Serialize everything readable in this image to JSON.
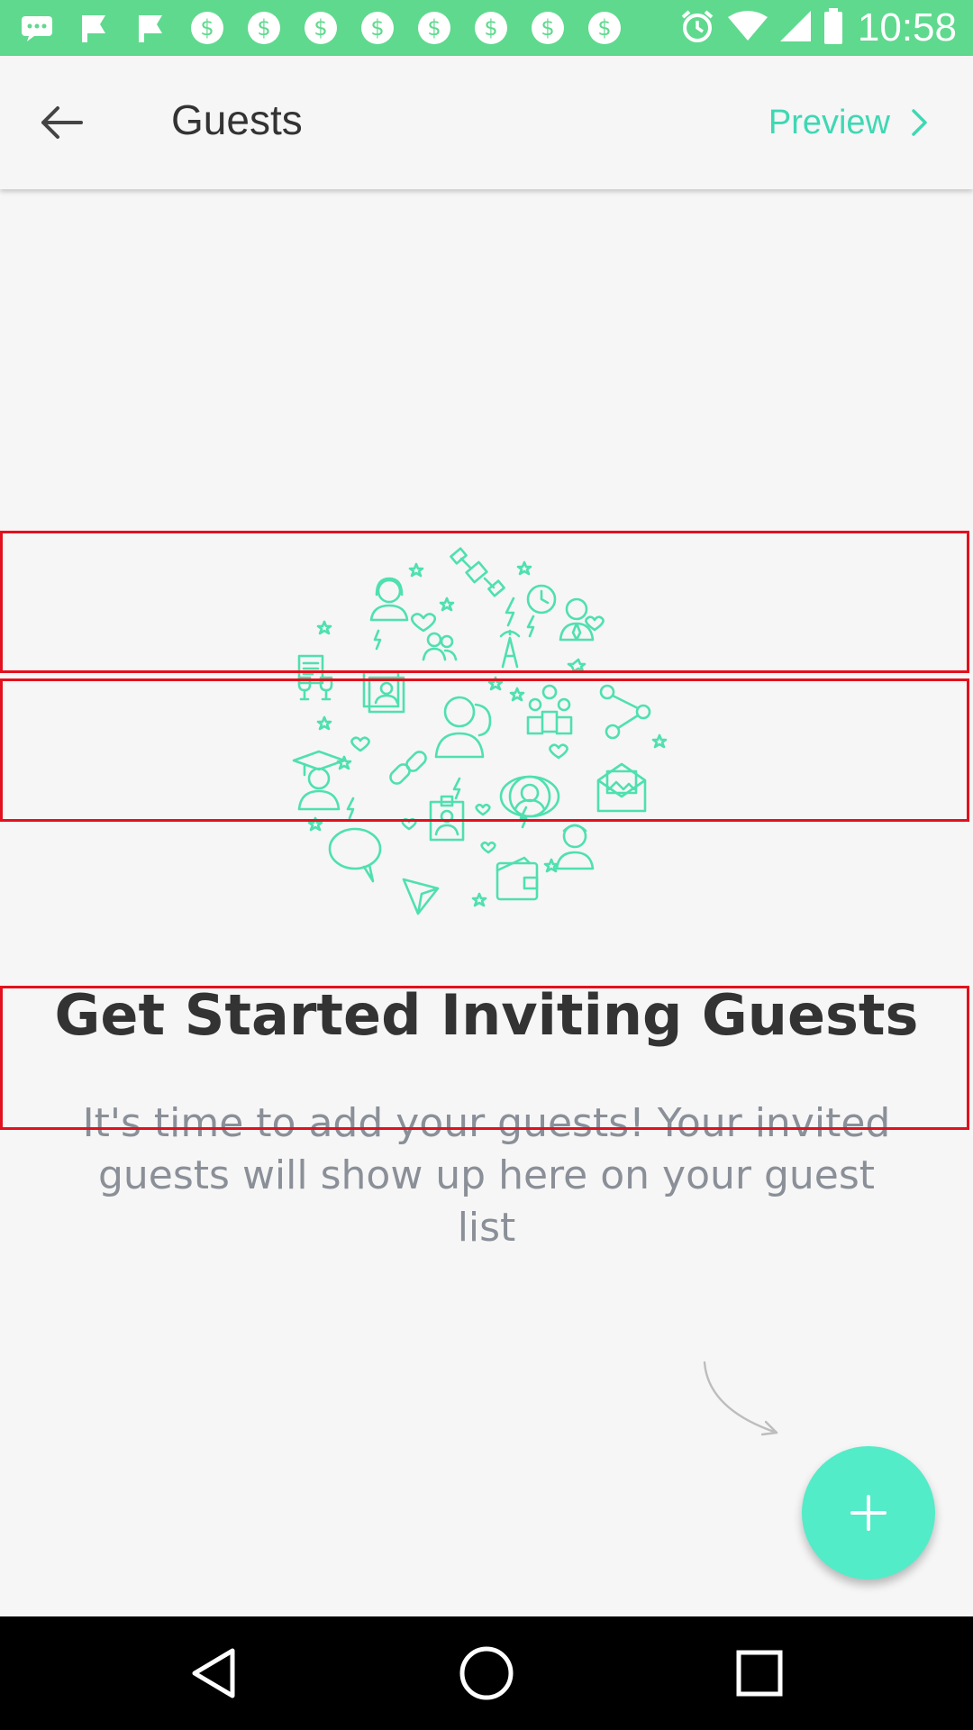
{
  "status_bar": {
    "time": "10:58",
    "icons": [
      "message-icon",
      "flip-icon",
      "flip-icon",
      "currency-icon",
      "currency-icon",
      "currency-icon",
      "currency-icon",
      "currency-icon",
      "currency-icon",
      "currency-icon",
      "currency-icon"
    ],
    "right_icons": [
      "alarm-icon",
      "wifi-icon",
      "signal-icon",
      "battery-icon"
    ],
    "background": "#5fd98e"
  },
  "app_bar": {
    "title": "Guests",
    "back_icon": "arrow-back-icon",
    "preview_label": "Preview",
    "preview_icon": "chevron-right-icon",
    "accent_color": "#3fd8b3"
  },
  "empty_state": {
    "illustration": "social-icons-circle-illustration",
    "headline": "Get Started Inviting Guests",
    "subtext": "It's time to add your guests! Your invited guests will show up here on your guest list"
  },
  "fab": {
    "icon": "plus-icon",
    "color": "#52ecc8"
  },
  "nav_bar": {
    "items": [
      "back-icon",
      "home-icon",
      "recents-icon"
    ]
  },
  "highlight_color": "#e3101d"
}
